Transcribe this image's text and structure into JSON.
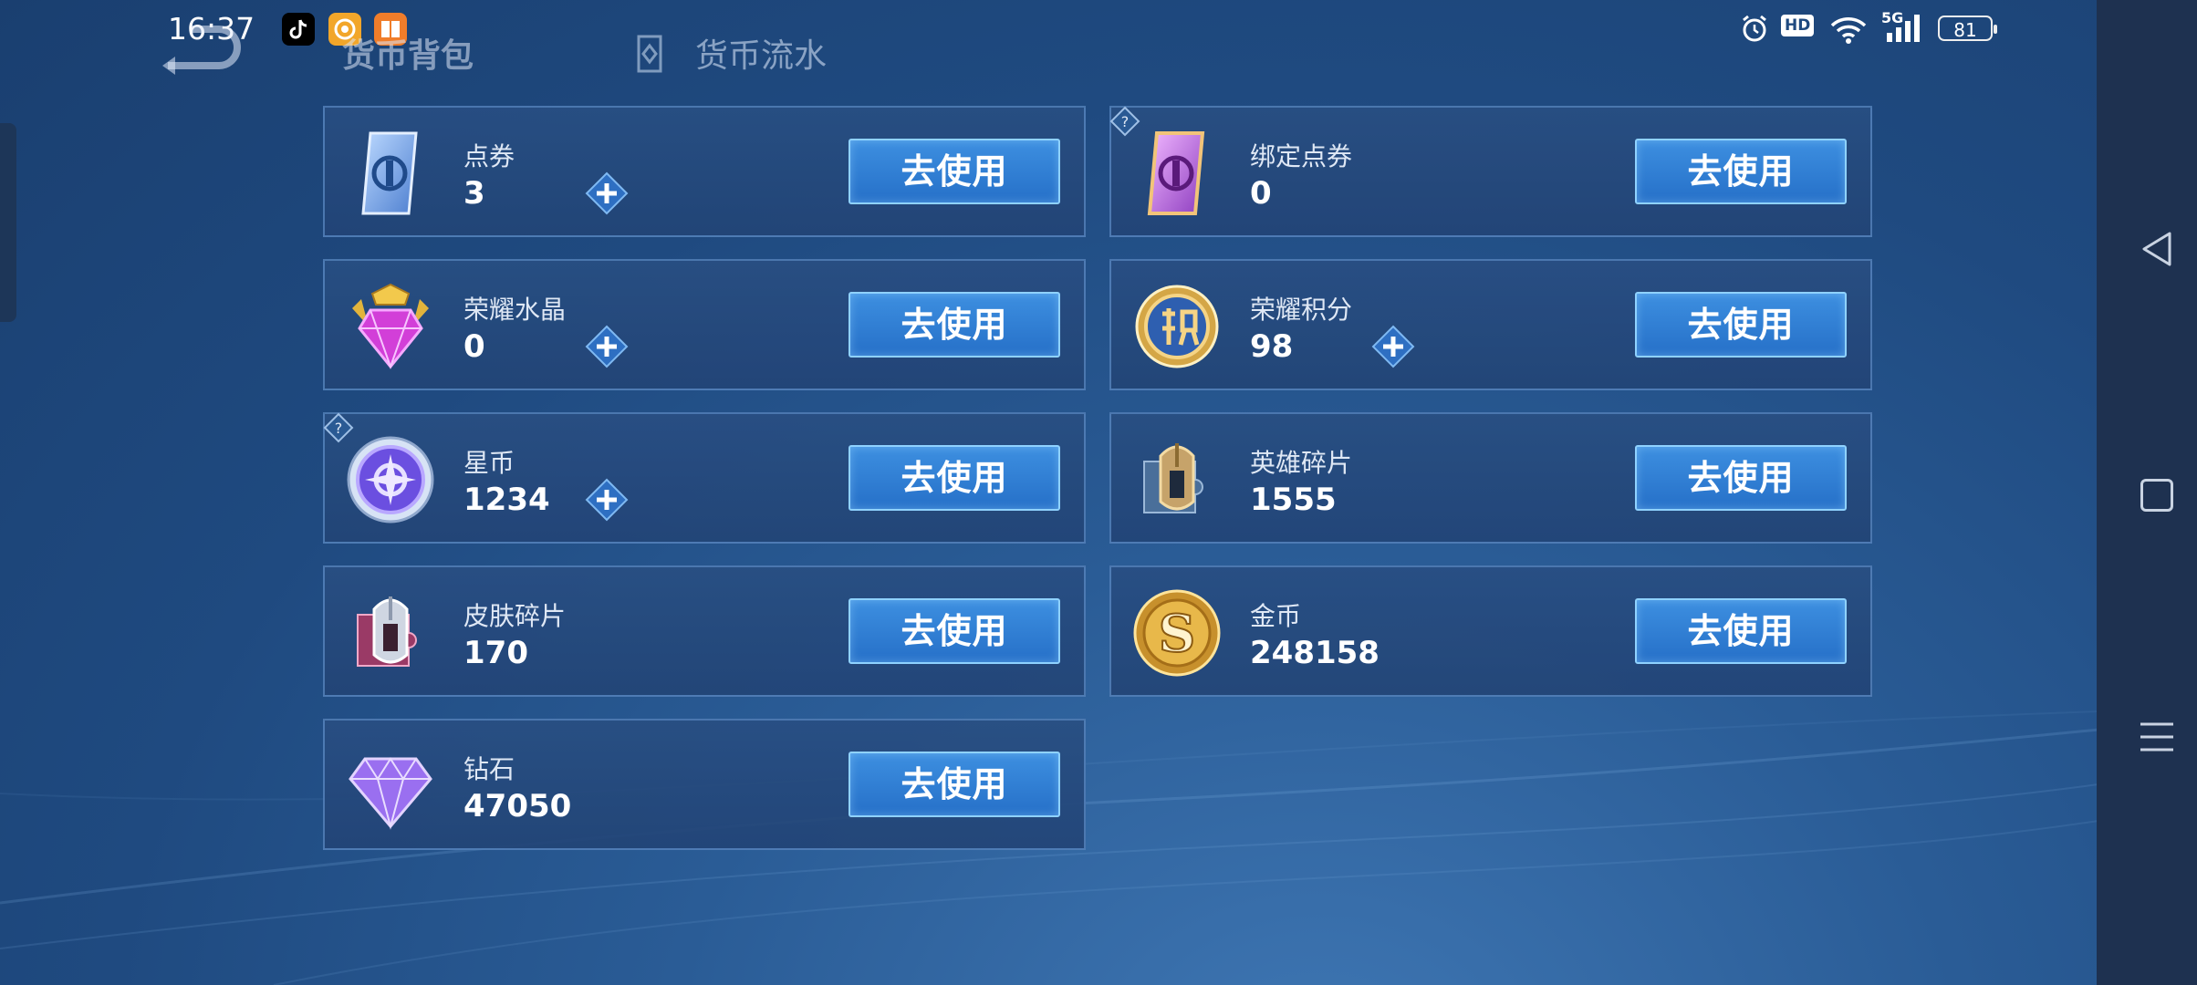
{
  "status_bar": {
    "time": "16:37",
    "hd_label": "HD",
    "network_label": "5G",
    "battery_level": "81"
  },
  "header": {
    "tabs": [
      {
        "label": "货币背包",
        "active": true
      },
      {
        "label": "货币流水",
        "active": false
      }
    ]
  },
  "currencies": [
    {
      "name": "点券",
      "value": "3",
      "button": "去使用",
      "has_plus": true,
      "has_help": false,
      "icon": "ticket-blue-icon"
    },
    {
      "name": "绑定点券",
      "value": "0",
      "button": "去使用",
      "has_plus": false,
      "has_help": true,
      "icon": "ticket-purple-icon"
    },
    {
      "name": "荣耀水晶",
      "value": "0",
      "button": "去使用",
      "has_plus": true,
      "has_help": false,
      "icon": "crystal-icon"
    },
    {
      "name": "荣耀积分",
      "value": "98",
      "button": "去使用",
      "has_plus": true,
      "has_help": false,
      "icon": "points-coin-icon"
    },
    {
      "name": "星币",
      "value": "1234",
      "button": "去使用",
      "has_plus": true,
      "has_help": true,
      "icon": "star-coin-icon"
    },
    {
      "name": "英雄碎片",
      "value": "1555",
      "button": "去使用",
      "has_plus": false,
      "has_help": false,
      "icon": "hero-fragment-icon"
    },
    {
      "name": "皮肤碎片",
      "value": "170",
      "button": "去使用",
      "has_plus": false,
      "has_help": false,
      "icon": "skin-fragment-icon"
    },
    {
      "name": "金币",
      "value": "248158",
      "button": "去使用",
      "has_plus": false,
      "has_help": false,
      "icon": "gold-coin-icon"
    },
    {
      "name": "钻石",
      "value": "47050",
      "button": "去使用",
      "has_plus": false,
      "has_help": false,
      "icon": "diamond-icon"
    }
  ],
  "colors": {
    "background": "#2a5c96",
    "button": "#2670c8",
    "button_border": "#8fd2ff",
    "nav_panel": "#1e3150"
  }
}
